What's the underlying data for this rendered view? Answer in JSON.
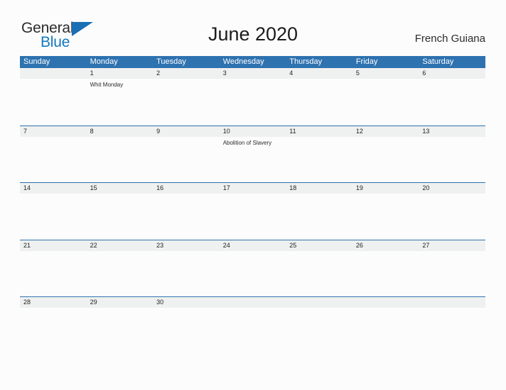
{
  "brand": {
    "name_part1": "General",
    "name_part2": "Blue",
    "flag_icon": "blue-triangle-flag-icon",
    "color_dark": "#2b2b2b",
    "color_blue": "#1278be"
  },
  "header": {
    "title": "June 2020",
    "locale": "French Guiana"
  },
  "theme": {
    "header_blue": "#2e72b0",
    "band_gray": "#eff0f0",
    "page_background": "#fcfcfd"
  },
  "calendar": {
    "month": "June",
    "year": "2020",
    "weekdays": [
      "Sunday",
      "Monday",
      "Tuesday",
      "Wednesday",
      "Thursday",
      "Friday",
      "Saturday"
    ],
    "weeks": [
      {
        "days": [
          {
            "date": "",
            "event": ""
          },
          {
            "date": "1",
            "event": "Whit Monday"
          },
          {
            "date": "2",
            "event": ""
          },
          {
            "date": "3",
            "event": ""
          },
          {
            "date": "4",
            "event": ""
          },
          {
            "date": "5",
            "event": ""
          },
          {
            "date": "6",
            "event": ""
          }
        ]
      },
      {
        "days": [
          {
            "date": "7",
            "event": ""
          },
          {
            "date": "8",
            "event": ""
          },
          {
            "date": "9",
            "event": ""
          },
          {
            "date": "10",
            "event": "Abolition of Slavery"
          },
          {
            "date": "11",
            "event": ""
          },
          {
            "date": "12",
            "event": ""
          },
          {
            "date": "13",
            "event": ""
          }
        ]
      },
      {
        "days": [
          {
            "date": "14",
            "event": ""
          },
          {
            "date": "15",
            "event": ""
          },
          {
            "date": "16",
            "event": ""
          },
          {
            "date": "17",
            "event": ""
          },
          {
            "date": "18",
            "event": ""
          },
          {
            "date": "19",
            "event": ""
          },
          {
            "date": "20",
            "event": ""
          }
        ]
      },
      {
        "days": [
          {
            "date": "21",
            "event": ""
          },
          {
            "date": "22",
            "event": ""
          },
          {
            "date": "23",
            "event": ""
          },
          {
            "date": "24",
            "event": ""
          },
          {
            "date": "25",
            "event": ""
          },
          {
            "date": "26",
            "event": ""
          },
          {
            "date": "27",
            "event": ""
          }
        ]
      },
      {
        "days": [
          {
            "date": "28",
            "event": ""
          },
          {
            "date": "29",
            "event": ""
          },
          {
            "date": "30",
            "event": ""
          },
          {
            "date": "",
            "event": ""
          },
          {
            "date": "",
            "event": ""
          },
          {
            "date": "",
            "event": ""
          },
          {
            "date": "",
            "event": ""
          }
        ]
      }
    ]
  }
}
